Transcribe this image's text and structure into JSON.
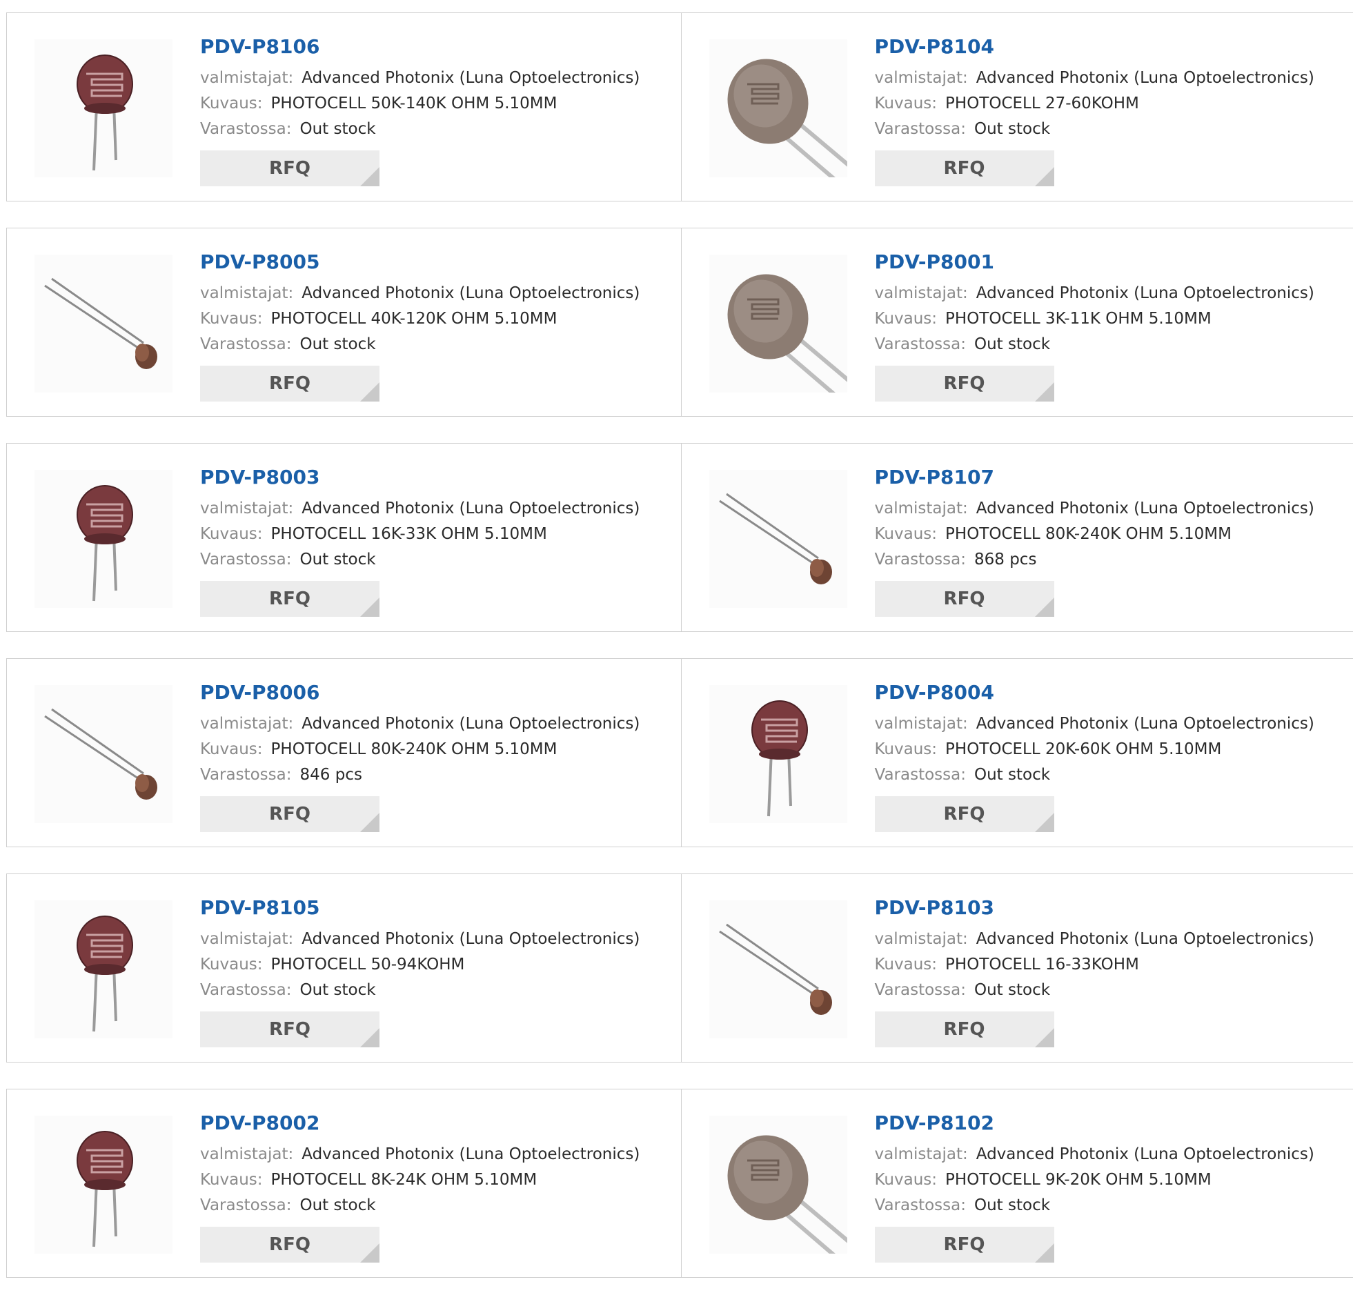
{
  "labels": {
    "manufacturer": "valmistajat:",
    "description": "Kuvaus:",
    "stock": "Varastossa:",
    "rfq": "RFQ"
  },
  "rows": [
    [
      {
        "part": "PDV-P8106",
        "manufacturer": "Advanced Photonix (Luna Optoelectronics)",
        "description": "PHOTOCELL 50K-140K OHM 5.10MM",
        "stock": "Out stock",
        "image": "photocell-front-icon"
      },
      {
        "part": "PDV-P8104",
        "manufacturer": "Advanced Photonix (Luna Optoelectronics)",
        "description": "PHOTOCELL 27-60KOHM",
        "stock": "Out stock",
        "image": "photocell-large-angled-icon"
      }
    ],
    [
      {
        "part": "PDV-P8005",
        "manufacturer": "Advanced Photonix (Luna Optoelectronics)",
        "description": "PHOTOCELL 40K-120K OHM 5.10MM",
        "stock": "Out stock",
        "image": "photocell-side-icon"
      },
      {
        "part": "PDV-P8001",
        "manufacturer": "Advanced Photonix (Luna Optoelectronics)",
        "description": "PHOTOCELL 3K-11K OHM 5.10MM",
        "stock": "Out stock",
        "image": "photocell-large-angled-icon"
      }
    ],
    [
      {
        "part": "PDV-P8003",
        "manufacturer": "Advanced Photonix (Luna Optoelectronics)",
        "description": "PHOTOCELL 16K-33K OHM 5.10MM",
        "stock": "Out stock",
        "image": "photocell-front-icon"
      },
      {
        "part": "PDV-P8107",
        "manufacturer": "Advanced Photonix (Luna Optoelectronics)",
        "description": "PHOTOCELL 80K-240K OHM 5.10MM",
        "stock": "868 pcs",
        "image": "photocell-side-icon"
      }
    ],
    [
      {
        "part": "PDV-P8006",
        "manufacturer": "Advanced Photonix (Luna Optoelectronics)",
        "description": "PHOTOCELL 80K-240K OHM 5.10MM",
        "stock": "846 pcs",
        "image": "photocell-side-icon"
      },
      {
        "part": "PDV-P8004",
        "manufacturer": "Advanced Photonix (Luna Optoelectronics)",
        "description": "PHOTOCELL 20K-60K OHM 5.10MM",
        "stock": "Out stock",
        "image": "photocell-front-icon"
      }
    ],
    [
      {
        "part": "PDV-P8105",
        "manufacturer": "Advanced Photonix (Luna Optoelectronics)",
        "description": "PHOTOCELL 50-94KOHM",
        "stock": "Out stock",
        "image": "photocell-front-icon"
      },
      {
        "part": "PDV-P8103",
        "manufacturer": "Advanced Photonix (Luna Optoelectronics)",
        "description": "PHOTOCELL 16-33KOHM",
        "stock": "Out stock",
        "image": "photocell-side-icon"
      }
    ],
    [
      {
        "part": "PDV-P8002",
        "manufacturer": "Advanced Photonix (Luna Optoelectronics)",
        "description": "PHOTOCELL 8K-24K OHM 5.10MM",
        "stock": "Out stock",
        "image": "photocell-front-icon"
      },
      {
        "part": "PDV-P8102",
        "manufacturer": "Advanced Photonix (Luna Optoelectronics)",
        "description": "PHOTOCELL 9K-20K OHM 5.10MM",
        "stock": "Out stock",
        "image": "photocell-large-angled-icon"
      }
    ]
  ]
}
